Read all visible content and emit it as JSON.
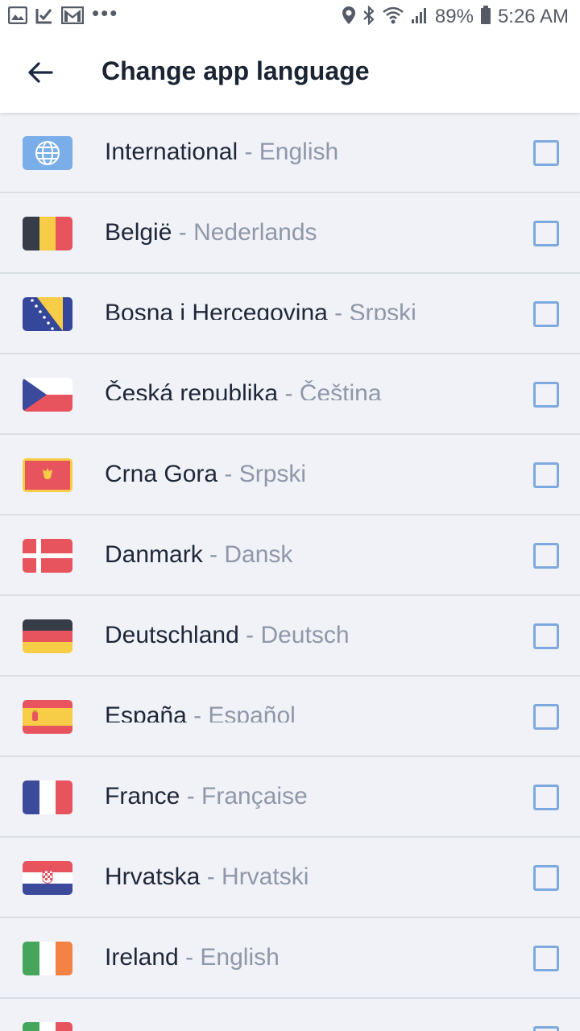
{
  "status_bar": {
    "battery": "89%",
    "time": "5:26 AM",
    "left_icons": [
      "gallery-icon",
      "download-check-icon",
      "gmail-icon",
      "more-dots-icon"
    ],
    "right_icons": [
      "location-icon",
      "bluetooth-icon",
      "wifi-icon",
      "signal-icon",
      "battery-icon"
    ]
  },
  "header": {
    "title": "Change app language",
    "back_icon": "arrow-left-icon"
  },
  "colors": {
    "background": "#f0f2f7",
    "checkbox_border": "#7ea9e0",
    "country_text": "#1e2738",
    "language_text": "#8f97a8"
  },
  "languages": [
    {
      "country": "International",
      "sep": " - ",
      "language": "English",
      "flag": "globe-flag-icon",
      "checked": false
    },
    {
      "country": "België",
      "sep": " - ",
      "language": "Nederlands",
      "flag": "belgium-flag-icon",
      "checked": false
    },
    {
      "country": "Bosna i Hercegovina",
      "sep": " - ",
      "language": "Srpski",
      "flag": "bosnia-flag-icon",
      "checked": false
    },
    {
      "country": "Česká republika",
      "sep": " - ",
      "language": "Čeština",
      "flag": "czech-flag-icon",
      "checked": false
    },
    {
      "country": "Crna Gora",
      "sep": " - ",
      "language": "Srpski",
      "flag": "montenegro-flag-icon",
      "checked": false
    },
    {
      "country": "Danmark",
      "sep": " - ",
      "language": "Dansk",
      "flag": "denmark-flag-icon",
      "checked": false
    },
    {
      "country": "Deutschland",
      "sep": " - ",
      "language": "Deutsch",
      "flag": "germany-flag-icon",
      "checked": false
    },
    {
      "country": "España",
      "sep": " - ",
      "language": "Español",
      "flag": "spain-flag-icon",
      "checked": false
    },
    {
      "country": "France",
      "sep": " - ",
      "language": "Française",
      "flag": "france-flag-icon",
      "checked": false
    },
    {
      "country": "Hrvatska",
      "sep": " - ",
      "language": "Hrvatski",
      "flag": "croatia-flag-icon",
      "checked": false
    },
    {
      "country": "Ireland",
      "sep": " - ",
      "language": "English",
      "flag": "ireland-flag-icon",
      "checked": false
    },
    {
      "country": "",
      "sep": "",
      "language": "",
      "flag": "italy-flag-icon",
      "checked": false
    }
  ]
}
